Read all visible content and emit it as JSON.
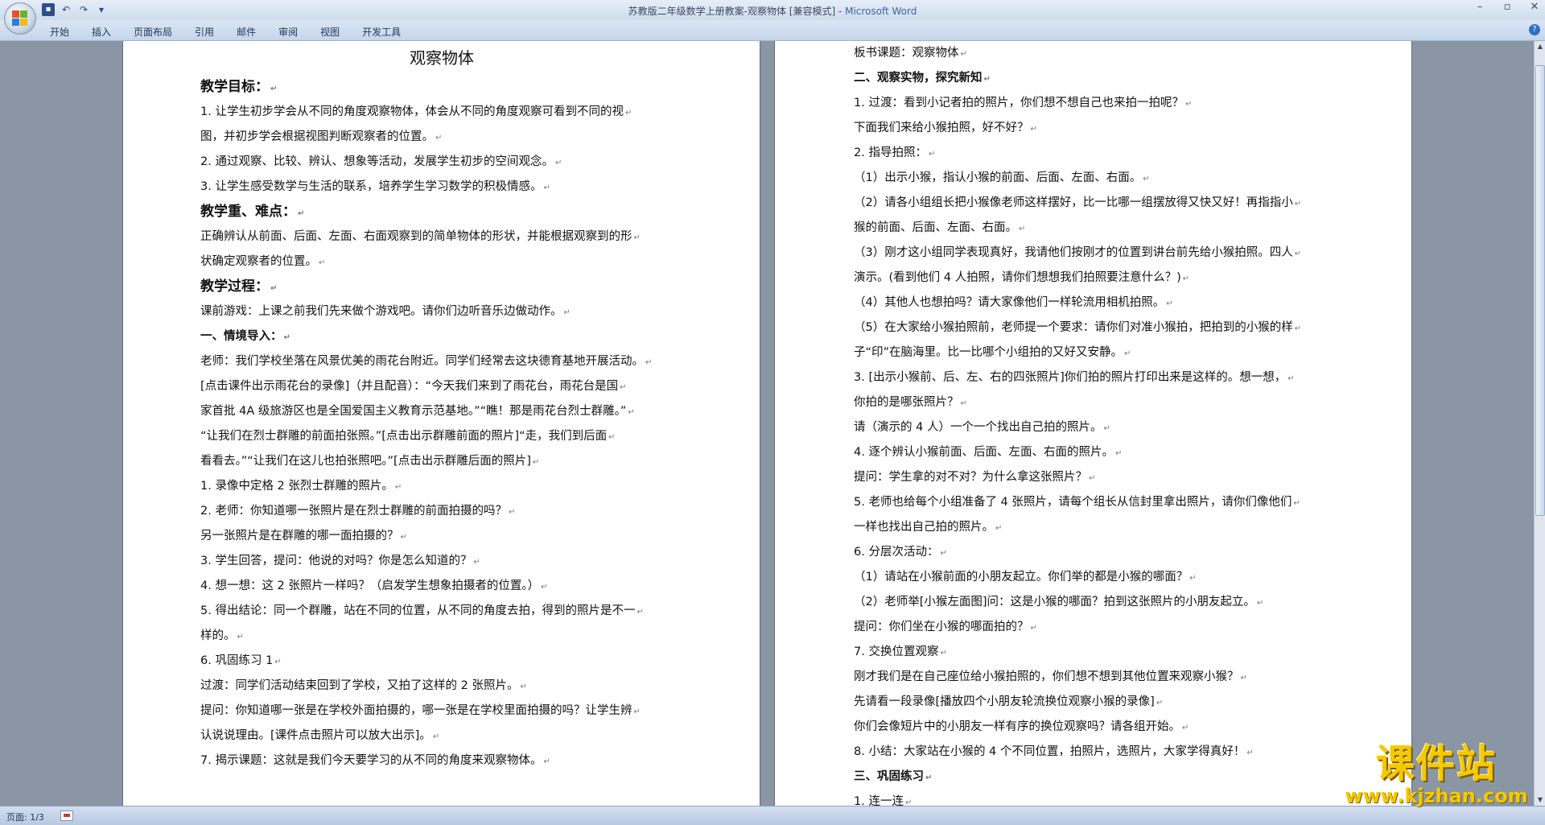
{
  "window": {
    "title": "苏教版二年级数学上册教案-观察物体 [兼容模式] - ",
    "app": "Microsoft Word"
  },
  "qat_icons": [
    "save-icon",
    "undo-icon",
    "redo-icon",
    "customize-icon"
  ],
  "ribbon": {
    "tabs": [
      "开始",
      "插入",
      "页面布局",
      "引用",
      "邮件",
      "审阅",
      "视图",
      "开发工具"
    ]
  },
  "page1": {
    "title": "观察物体",
    "lines": [
      {
        "t": "教学目标：",
        "s": "h"
      },
      {
        "t": "1. 让学生初步学会从不同的角度观察物体，体会从不同的角度观察可看到不同的视",
        "s": "n"
      },
      {
        "t": "图，并初步学会根据视图判断观察者的位置。",
        "s": "n"
      },
      {
        "t": "2. 通过观察、比较、辨认、想象等活动，发展学生初步的空间观念。",
        "s": "n"
      },
      {
        "t": "3. 让学生感受数学与生活的联系，培养学生学习数学的积极情感。",
        "s": "n"
      },
      {
        "t": "教学重、难点：",
        "s": "h"
      },
      {
        "t": "正确辨认从前面、后面、左面、右面观察到的简单物体的形状，并能根据观察到的形",
        "s": "n"
      },
      {
        "t": "状确定观察者的位置。",
        "s": "n"
      },
      {
        "t": "教学过程：",
        "s": "h"
      },
      {
        "t": "课前游戏：上课之前我们先来做个游戏吧。请你们边听音乐边做动作。",
        "s": "n"
      },
      {
        "t": "一、情境导入：",
        "s": "b"
      },
      {
        "t": "老师：我们学校坐落在风景优美的雨花台附近。同学们经常去这块德育基地开展活动。",
        "s": "n"
      },
      {
        "t": "[点击课件出示雨花台的录像]（并且配音）：“今天我们来到了雨花台，雨花台是国",
        "s": "n"
      },
      {
        "t": "家首批 4A 级旅游区也是全国爱国主义教育示范基地。”“瞧！那是雨花台烈士群雕。”",
        "s": "n"
      },
      {
        "t": "“让我们在烈士群雕的前面拍张照。”[点击出示群雕前面的照片]“走，我们到后面",
        "s": "n"
      },
      {
        "t": "看看去。”“让我们在这儿也拍张照吧。”[点击出示群雕后面的照片]",
        "s": "n"
      },
      {
        "t": "1. 录像中定格 2 张烈士群雕的照片。",
        "s": "n"
      },
      {
        "t": "2. 老师：你知道哪一张照片是在烈士群雕的前面拍摄的吗？",
        "s": "n"
      },
      {
        "t": "另一张照片是在群雕的哪一面拍摄的？",
        "s": "n"
      },
      {
        "t": "3. 学生回答，提问：他说的对吗？你是怎么知道的？",
        "s": "n"
      },
      {
        "t": "4. 想一想：这 2 张照片一样吗？（启发学生想象拍摄者的位置。）",
        "s": "n"
      },
      {
        "t": "5. 得出结论：同一个群雕，站在不同的位置，从不同的角度去拍，得到的照片是不一",
        "s": "n"
      },
      {
        "t": "样的。",
        "s": "n"
      },
      {
        "t": "6. 巩固练习 1",
        "s": "n"
      },
      {
        "t": "过渡：同学们活动结束回到了学校，又拍了这样的 2 张照片。",
        "s": "n"
      },
      {
        "t": "提问：你知道哪一张是在学校外面拍摄的，哪一张是在学校里面拍摄的吗？让学生辨",
        "s": "n"
      },
      {
        "t": "认说说理由。[课件点击照片可以放大出示]。",
        "s": "n"
      },
      {
        "t": "7. 揭示课题：这就是我们今天要学习的从不同的角度来观察物体。",
        "s": "n"
      }
    ]
  },
  "page2": {
    "lines": [
      {
        "t": "板书课题：观察物体",
        "s": "n"
      },
      {
        "t": "二、观察实物，探究新知",
        "s": "b"
      },
      {
        "t": "1. 过渡：看到小记者拍的照片，你们想不想自己也来拍一拍呢？",
        "s": "n"
      },
      {
        "t": "下面我们来给小猴拍照，好不好？",
        "s": "n"
      },
      {
        "t": "2. 指导拍照：",
        "s": "n"
      },
      {
        "t": "（1）出示小猴，指认小猴的前面、后面、左面、右面。",
        "s": "n"
      },
      {
        "t": "（2）请各小组组长把小猴像老师这样摆好，比一比哪一组摆放得又快又好！再指指小",
        "s": "n"
      },
      {
        "t": "猴的前面、后面、左面、右面。",
        "s": "n"
      },
      {
        "t": "（3）刚才这小组同学表现真好，我请他们按刚才的位置到讲台前先给小猴拍照。四人",
        "s": "n"
      },
      {
        "t": "演示。(看到他们 4 人拍照，请你们想想我们拍照要注意什么？)",
        "s": "n"
      },
      {
        "t": "（4）其他人也想拍吗？请大家像他们一样轮流用相机拍照。",
        "s": "n"
      },
      {
        "t": "（5）在大家给小猴拍照前，老师提一个要求：请你们对准小猴拍，把拍到的小猴的样",
        "s": "n"
      },
      {
        "t": "子“印”在脑海里。比一比哪个小组拍的又好又安静。",
        "s": "n"
      },
      {
        "t": "3. [出示小猴前、后、左、右的四张照片]你们拍的照片打印出来是这样的。想一想，",
        "s": "n"
      },
      {
        "t": "你拍的是哪张照片？",
        "s": "n"
      },
      {
        "t": "请（演示的 4 人）一个一个找出自己拍的照片。",
        "s": "n"
      },
      {
        "t": "4. 逐个辨认小猴前面、后面、左面、右面的照片。",
        "s": "n"
      },
      {
        "t": "提问：学生拿的对不对？为什么拿这张照片？",
        "s": "n"
      },
      {
        "t": "5. 老师也给每个小组准备了 4 张照片，请每个组长从信封里拿出照片，请你们像他们",
        "s": "n"
      },
      {
        "t": "一样也找出自己拍的照片。",
        "s": "n"
      },
      {
        "t": "6. 分层次活动：",
        "s": "n"
      },
      {
        "t": "（1）请站在小猴前面的小朋友起立。你们举的都是小猴的哪面？",
        "s": "n"
      },
      {
        "t": "（2）老师举[小猴左面图]问：这是小猴的哪面？拍到这张照片的小朋友起立。",
        "s": "n"
      },
      {
        "t": "提问：你们坐在小猴的哪面拍的？",
        "s": "n"
      },
      {
        "t": "7. 交换位置观察",
        "s": "n"
      },
      {
        "t": "刚才我们是在自己座位给小猴拍照的，你们想不想到其他位置来观察小猴？",
        "s": "n"
      },
      {
        "t": "先请看一段录像[播放四个小朋友轮流换位观察小猴的录像]",
        "s": "n"
      },
      {
        "t": "你们会像短片中的小朋友一样有序的换位观察吗？请各组开始。",
        "s": "n"
      },
      {
        "t": "8. 小结：大家站在小猴的 4 个不同位置，拍照片，选照片，大家学得真好！",
        "s": "n"
      },
      {
        "t": "三、巩固练习",
        "s": "b"
      },
      {
        "t": "1. 连一连",
        "s": "n"
      }
    ]
  },
  "statusbar": {
    "page": "页面: 1/3"
  },
  "watermark": {
    "text": "课件站",
    "url": "www.kjzhan.com"
  }
}
